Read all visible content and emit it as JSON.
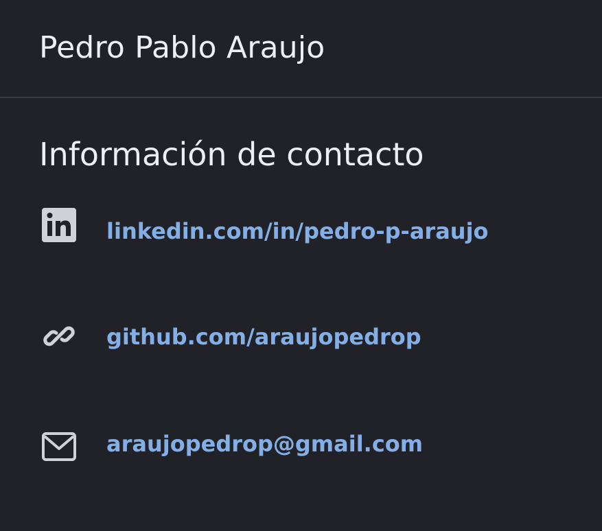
{
  "header": {
    "name": "Pedro Pablo Araujo"
  },
  "contact": {
    "title": "Información de contacto",
    "items": [
      {
        "icon": "linkedin-icon",
        "text": "linkedin.com/in/pedro-p-araujo"
      },
      {
        "icon": "link-icon",
        "text": "github.com/araujopedrop"
      },
      {
        "icon": "envelope-icon",
        "text": "araujopedrop@gmail.com"
      }
    ]
  },
  "colors": {
    "background": "#202227",
    "text": "#eceff3",
    "link": "#84aee6",
    "icon": "#cfd3d8",
    "divider": "#3a3d43"
  }
}
